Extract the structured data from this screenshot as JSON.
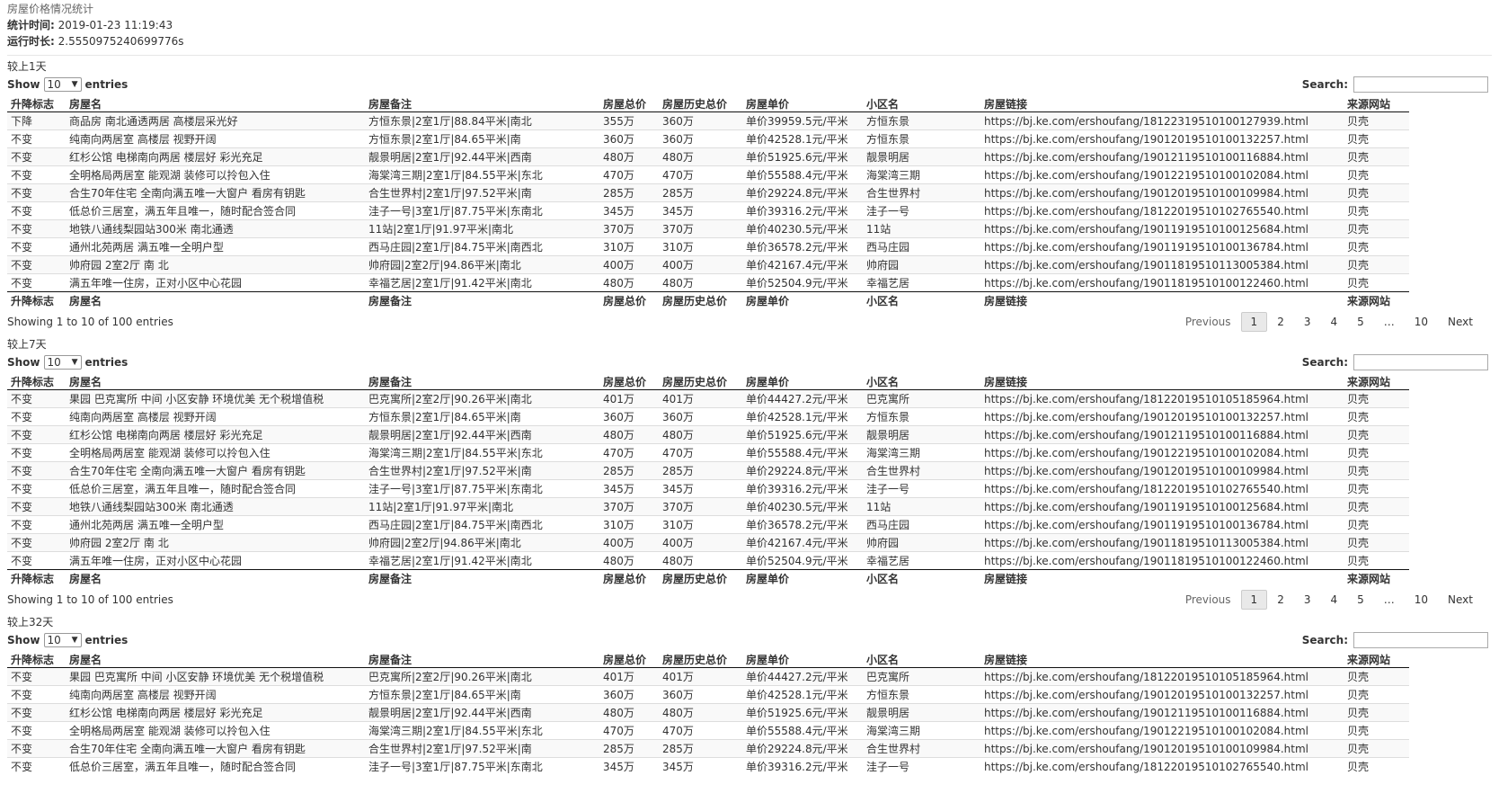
{
  "report_title": "房屋价格情况统计",
  "meta": {
    "time_label": "统计时间:",
    "time_value": "2019-01-23 11:19:43",
    "runtime_label": "运行时长:",
    "runtime_value": "2.5550975240699776s"
  },
  "controls": {
    "show_label": "Show",
    "entries_label": "entries",
    "page_length": "10",
    "search_label": "Search:"
  },
  "columns": [
    "升降标志",
    "房屋名",
    "房屋备注",
    "房屋总价",
    "房屋历史总价",
    "房屋单价",
    "小区名",
    "房屋链接",
    "来源网站"
  ],
  "pagination": {
    "info": "Showing 1 to 10 of 100 entries",
    "previous": "Previous",
    "pages": [
      "1",
      "2",
      "3",
      "4",
      "5",
      "…",
      "10"
    ],
    "next": "Next"
  },
  "sections": [
    {
      "title": "较上1天",
      "rows": [
        [
          "下降",
          "商品房 南北通透两居 高楼层采光好",
          "方恒东景|2室1厅|88.84平米|南北",
          "355万",
          "360万",
          "单价39959.5元/平米",
          "方恒东景",
          "https://bj.ke.com/ershoufang/18122319510100127939.html",
          "贝壳"
        ],
        [
          "不变",
          "纯南向两居室 高楼层 视野开阔",
          "方恒东景|2室1厅|84.65平米|南",
          "360万",
          "360万",
          "单价42528.1元/平米",
          "方恒东景",
          "https://bj.ke.com/ershoufang/19012019510100132257.html",
          "贝壳"
        ],
        [
          "不变",
          "红杉公馆 电梯南向两居 楼层好 彩光充足",
          "靓景明居|2室1厅|92.44平米|西南",
          "480万",
          "480万",
          "单价51925.6元/平米",
          "靓景明居",
          "https://bj.ke.com/ershoufang/19012119510100116884.html",
          "贝壳"
        ],
        [
          "不变",
          "全明格局两居室 能观湖 装修可以拎包入住",
          "海棠湾三期|2室1厅|84.55平米|东北",
          "470万",
          "470万",
          "单价55588.4元/平米",
          "海棠湾三期",
          "https://bj.ke.com/ershoufang/19012219510100102084.html",
          "贝壳"
        ],
        [
          "不变",
          "合生70年住宅 全南向满五唯一大窗户 看房有钥匙",
          "合生世界村|2室1厅|97.52平米|南",
          "285万",
          "285万",
          "单价29224.8元/平米",
          "合生世界村",
          "https://bj.ke.com/ershoufang/19012019510100109984.html",
          "贝壳"
        ],
        [
          "不变",
          "低总价三居室，满五年且唯一，随时配合签合同",
          "洼子一号|3室1厅|87.75平米|东南北",
          "345万",
          "345万",
          "单价39316.2元/平米",
          "洼子一号",
          "https://bj.ke.com/ershoufang/18122019510102765540.html",
          "贝壳"
        ],
        [
          "不变",
          "地铁八通线梨园站300米 南北通透",
          "11站|2室1厅|91.97平米|南北",
          "370万",
          "370万",
          "单价40230.5元/平米",
          "11站",
          "https://bj.ke.com/ershoufang/19011919510100125684.html",
          "贝壳"
        ],
        [
          "不变",
          "通州北苑两居 满五唯一全明户型",
          "西马庄园|2室1厅|84.75平米|南西北",
          "310万",
          "310万",
          "单价36578.2元/平米",
          "西马庄园",
          "https://bj.ke.com/ershoufang/19011919510100136784.html",
          "贝壳"
        ],
        [
          "不变",
          "帅府园 2室2厅 南 北",
          "帅府园|2室2厅|94.86平米|南北",
          "400万",
          "400万",
          "单价42167.4元/平米",
          "帅府园",
          "https://bj.ke.com/ershoufang/19011819510113005384.html",
          "贝壳"
        ],
        [
          "不变",
          "满五年唯一住房，正对小区中心花园",
          "幸福艺居|2室1厅|91.42平米|南北",
          "480万",
          "480万",
          "单价52504.9元/平米",
          "幸福艺居",
          "https://bj.ke.com/ershoufang/19011819510100122460.html",
          "贝壳"
        ]
      ]
    },
    {
      "title": "较上7天",
      "rows": [
        [
          "不变",
          "果园 巴克寓所 中间 小区安静 环境优美 无个税增值税",
          "巴克寓所|2室2厅|90.26平米|南北",
          "401万",
          "401万",
          "单价44427.2元/平米",
          "巴克寓所",
          "https://bj.ke.com/ershoufang/18122019510105185964.html",
          "贝壳"
        ],
        [
          "不变",
          "纯南向两居室 高楼层 视野开阔",
          "方恒东景|2室1厅|84.65平米|南",
          "360万",
          "360万",
          "单价42528.1元/平米",
          "方恒东景",
          "https://bj.ke.com/ershoufang/19012019510100132257.html",
          "贝壳"
        ],
        [
          "不变",
          "红杉公馆 电梯南向两居 楼层好 彩光充足",
          "靓景明居|2室1厅|92.44平米|西南",
          "480万",
          "480万",
          "单价51925.6元/平米",
          "靓景明居",
          "https://bj.ke.com/ershoufang/19012119510100116884.html",
          "贝壳"
        ],
        [
          "不变",
          "全明格局两居室 能观湖 装修可以拎包入住",
          "海棠湾三期|2室1厅|84.55平米|东北",
          "470万",
          "470万",
          "单价55588.4元/平米",
          "海棠湾三期",
          "https://bj.ke.com/ershoufang/19012219510100102084.html",
          "贝壳"
        ],
        [
          "不变",
          "合生70年住宅 全南向满五唯一大窗户 看房有钥匙",
          "合生世界村|2室1厅|97.52平米|南",
          "285万",
          "285万",
          "单价29224.8元/平米",
          "合生世界村",
          "https://bj.ke.com/ershoufang/19012019510100109984.html",
          "贝壳"
        ],
        [
          "不变",
          "低总价三居室，满五年且唯一，随时配合签合同",
          "洼子一号|3室1厅|87.75平米|东南北",
          "345万",
          "345万",
          "单价39316.2元/平米",
          "洼子一号",
          "https://bj.ke.com/ershoufang/18122019510102765540.html",
          "贝壳"
        ],
        [
          "不变",
          "地铁八通线梨园站300米 南北通透",
          "11站|2室1厅|91.97平米|南北",
          "370万",
          "370万",
          "单价40230.5元/平米",
          "11站",
          "https://bj.ke.com/ershoufang/19011919510100125684.html",
          "贝壳"
        ],
        [
          "不变",
          "通州北苑两居 满五唯一全明户型",
          "西马庄园|2室1厅|84.75平米|南西北",
          "310万",
          "310万",
          "单价36578.2元/平米",
          "西马庄园",
          "https://bj.ke.com/ershoufang/19011919510100136784.html",
          "贝壳"
        ],
        [
          "不变",
          "帅府园 2室2厅 南 北",
          "帅府园|2室2厅|94.86平米|南北",
          "400万",
          "400万",
          "单价42167.4元/平米",
          "帅府园",
          "https://bj.ke.com/ershoufang/19011819510113005384.html",
          "贝壳"
        ],
        [
          "不变",
          "满五年唯一住房，正对小区中心花园",
          "幸福艺居|2室1厅|91.42平米|南北",
          "480万",
          "480万",
          "单价52504.9元/平米",
          "幸福艺居",
          "https://bj.ke.com/ershoufang/19011819510100122460.html",
          "贝壳"
        ]
      ]
    },
    {
      "title": "较上32天",
      "rows": [
        [
          "不变",
          "果园 巴克寓所 中间 小区安静 环境优美 无个税增值税",
          "巴克寓所|2室2厅|90.26平米|南北",
          "401万",
          "401万",
          "单价44427.2元/平米",
          "巴克寓所",
          "https://bj.ke.com/ershoufang/18122019510105185964.html",
          "贝壳"
        ],
        [
          "不变",
          "纯南向两居室 高楼层 视野开阔",
          "方恒东景|2室1厅|84.65平米|南",
          "360万",
          "360万",
          "单价42528.1元/平米",
          "方恒东景",
          "https://bj.ke.com/ershoufang/19012019510100132257.html",
          "贝壳"
        ],
        [
          "不变",
          "红杉公馆 电梯南向两居 楼层好 彩光充足",
          "靓景明居|2室1厅|92.44平米|西南",
          "480万",
          "480万",
          "单价51925.6元/平米",
          "靓景明居",
          "https://bj.ke.com/ershoufang/19012119510100116884.html",
          "贝壳"
        ],
        [
          "不变",
          "全明格局两居室 能观湖 装修可以拎包入住",
          "海棠湾三期|2室1厅|84.55平米|东北",
          "470万",
          "470万",
          "单价55588.4元/平米",
          "海棠湾三期",
          "https://bj.ke.com/ershoufang/19012219510100102084.html",
          "贝壳"
        ],
        [
          "不变",
          "合生70年住宅 全南向满五唯一大窗户 看房有钥匙",
          "合生世界村|2室1厅|97.52平米|南",
          "285万",
          "285万",
          "单价29224.8元/平米",
          "合生世界村",
          "https://bj.ke.com/ershoufang/19012019510100109984.html",
          "贝壳"
        ],
        [
          "不变",
          "低总价三居室，满五年且唯一，随时配合签合同",
          "洼子一号|3室1厅|87.75平米|东南北",
          "345万",
          "345万",
          "单价39316.2元/平米",
          "洼子一号",
          "https://bj.ke.com/ershoufang/18122019510102765540.html",
          "贝壳"
        ]
      ]
    }
  ]
}
